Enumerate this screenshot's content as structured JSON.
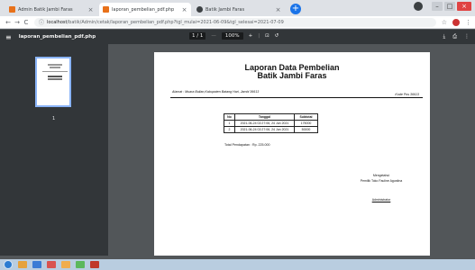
{
  "browser": {
    "tabs": [
      {
        "title": "Admin Batik Jambi Faras",
        "favicon_color": "#e8711a",
        "active": false
      },
      {
        "title": "laporan_pembelian_pdf.php",
        "favicon_color": "#e8711a",
        "active": true
      },
      {
        "title": "Batik Jambi Faras",
        "favicon_color": "#3c4043",
        "active": false
      }
    ],
    "newtab_label": "+",
    "url_host": "localhost",
    "url_path": "/batik/Admin/cetak/laporan_pembelian_pdf.php?tgl_mulai=2021-06-09&tgl_selesai=2021-07-09"
  },
  "pdf_viewer": {
    "filename": "laporan_pembelian_pdf.php",
    "page_indicator": "1 / 1",
    "zoom": "100%",
    "zoom_out": "—",
    "zoom_in": "+",
    "thumbnail_number": "1"
  },
  "document": {
    "title_line1": "Laporan Data Pembelian",
    "title_line2": "Batik Jambi Faras",
    "address": "Alamat : Muara Bulian,Kabupaten Batang Hari, Jambi 36613",
    "postal_code": "Kode Pos 36613",
    "table": {
      "headers": [
        "No",
        "Tanggal",
        "Subtotal"
      ],
      "rows": [
        [
          "1",
          "2021-06-24 02:27:06, 24 Jun 2021",
          "175000"
        ],
        [
          "2",
          "2021-06-24 02:27:06, 24 Jun 2021",
          "50000"
        ]
      ]
    },
    "total": "Total Pendapatan : Rp. 225.000",
    "sign_city": "Mengetahui",
    "sign_role": "Pemilik Toko Fauline Agustina",
    "sign_name": "Administrator"
  },
  "colors": {
    "viewer_bg": "#525659",
    "toolbar_bg": "#323639",
    "tab_strip": "#dee1e6",
    "accent": "#1a73e8",
    "taskbar": "#b9cde0"
  },
  "taskbar": {
    "apps": [
      "#e6a23c",
      "#3a7bd5",
      "#d9534f",
      "#f0ad4e",
      "#5cb85c",
      "#c0392b"
    ]
  }
}
